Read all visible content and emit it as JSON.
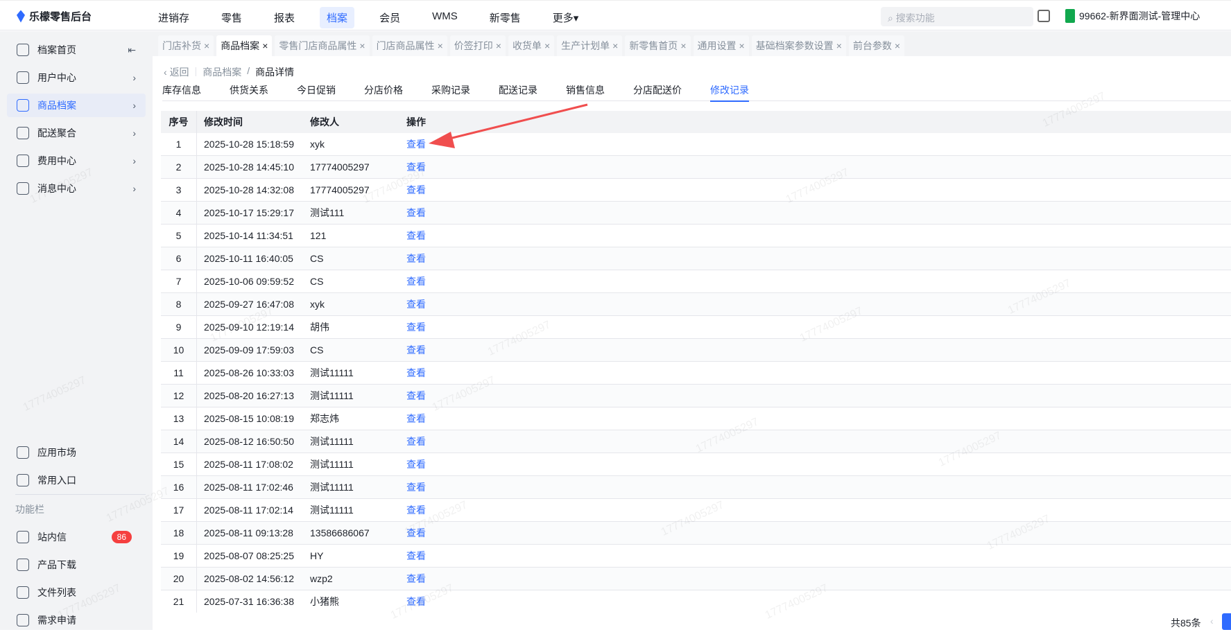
{
  "app": {
    "title": "乐檬零售后台",
    "search_placeholder": "搜索功能",
    "store": "99662-新界面测试-管理中心"
  },
  "nav": [
    "进销存",
    "零售",
    "报表",
    "档案",
    "会员",
    "WMS",
    "新零售",
    "更多▾"
  ],
  "nav_active": 3,
  "sidebar": {
    "items": [
      {
        "label": "档案首页",
        "icon": "home-icon"
      },
      {
        "label": "用户中心",
        "icon": "user-icon"
      },
      {
        "label": "商品档案",
        "icon": "product-icon"
      },
      {
        "label": "配送聚合",
        "icon": "delivery-icon"
      },
      {
        "label": "费用中心",
        "icon": "yen-icon"
      },
      {
        "label": "消息中心",
        "icon": "bell-icon"
      }
    ],
    "bottom": [
      {
        "label": "应用市场",
        "icon": "app-market-icon"
      },
      {
        "label": "常用入口",
        "icon": "heart-icon"
      }
    ],
    "group_label": "功能栏",
    "tools": [
      {
        "label": "站内信",
        "icon": "mail-icon",
        "badge": "86"
      },
      {
        "label": "产品下载",
        "icon": "download-icon"
      },
      {
        "label": "文件列表",
        "icon": "chart-file-icon"
      },
      {
        "label": "需求申请",
        "icon": "message-icon"
      }
    ]
  },
  "tabs": [
    "门店补货",
    "商品档案",
    "零售门店商品属性",
    "门店商品属性",
    "价签打印",
    "收货单",
    "生产计划单",
    "新零售首页",
    "通用设置",
    "基础档案参数设置",
    "前台参数"
  ],
  "tab_active": 1,
  "breadcrumb": {
    "back": "返回",
    "parent": "商品档案",
    "current": "商品详情"
  },
  "subtabs": [
    "库存信息",
    "供货关系",
    "今日促销",
    "分店价格",
    "采购记录",
    "配送记录",
    "销售信息",
    "分店配送价",
    "修改记录"
  ],
  "subtab_active": 8,
  "table": {
    "headers": [
      "序号",
      "修改时间",
      "修改人",
      "操作"
    ],
    "rows": [
      [
        "1",
        "2025-10-28 15:18:59",
        "xyk",
        "查看"
      ],
      [
        "2",
        "2025-10-28 14:45:10",
        "17774005297",
        "查看"
      ],
      [
        "3",
        "2025-10-28 14:32:08",
        "17774005297",
        "查看"
      ],
      [
        "4",
        "2025-10-17 15:29:17",
        "测试111",
        "查看"
      ],
      [
        "5",
        "2025-10-14 11:34:51",
        "121",
        "查看"
      ],
      [
        "6",
        "2025-10-11 16:40:05",
        "CS",
        "查看"
      ],
      [
        "7",
        "2025-10-06 09:59:52",
        "CS",
        "查看"
      ],
      [
        "8",
        "2025-09-27 16:47:08",
        "xyk",
        "查看"
      ],
      [
        "9",
        "2025-09-10 12:19:14",
        "胡伟",
        "查看"
      ],
      [
        "10",
        "2025-09-09 17:59:03",
        "CS",
        "查看"
      ],
      [
        "11",
        "2025-08-26 10:33:03",
        "测试11111",
        "查看"
      ],
      [
        "12",
        "2025-08-20 16:27:13",
        "测试11111",
        "查看"
      ],
      [
        "13",
        "2025-08-15 10:08:19",
        "郑志炜",
        "查看"
      ],
      [
        "14",
        "2025-08-12 16:50:50",
        "测试11111",
        "查看"
      ],
      [
        "15",
        "2025-08-11 17:08:02",
        "测试11111",
        "查看"
      ],
      [
        "16",
        "2025-08-11 17:02:46",
        "测试11111",
        "查看"
      ],
      [
        "17",
        "2025-08-11 17:02:14",
        "测试11111",
        "查看"
      ],
      [
        "18",
        "2025-08-11 09:13:28",
        "13586686067",
        "查看"
      ],
      [
        "19",
        "2025-08-07 08:25:25",
        "HY",
        "查看"
      ],
      [
        "20",
        "2025-08-02 14:56:12",
        "wzp2",
        "查看"
      ],
      [
        "21",
        "2025-07-31 16:36:38",
        "小猪熊",
        "查看"
      ]
    ]
  },
  "pagination": {
    "total": "共85条"
  },
  "watermark": "17774005297",
  "colors": {
    "accent": "#2f6bff",
    "badge": "#f53f3f",
    "arrow": "#f04e4e"
  }
}
